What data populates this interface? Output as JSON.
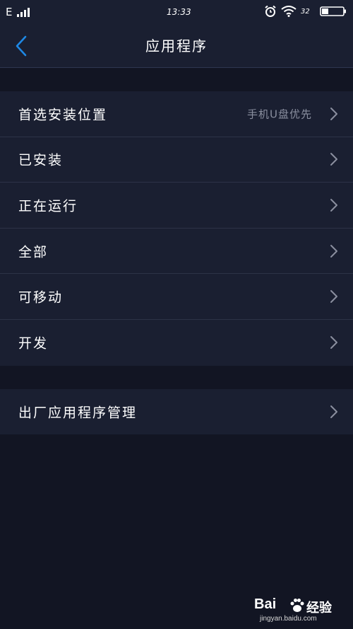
{
  "status_bar": {
    "network": "E",
    "time": "13:33",
    "battery_percent": "32",
    "icons": [
      "signal-icon",
      "alarm-icon",
      "wifi-icon",
      "battery-icon"
    ]
  },
  "nav": {
    "title": "应用程序",
    "back_icon": "chevron-left-icon"
  },
  "groups": [
    {
      "items": [
        {
          "label": "首选安装位置",
          "value": "手机U盘优先"
        },
        {
          "label": "已安装"
        },
        {
          "label": "正在运行"
        },
        {
          "label": "全部"
        },
        {
          "label": "可移动"
        },
        {
          "label": "开发"
        }
      ]
    },
    {
      "items": [
        {
          "label": "出厂应用程序管理"
        }
      ]
    }
  ],
  "watermark": {
    "brand": "Bai",
    "suffix": "经验",
    "url": "jingyan.baidu.com"
  },
  "colors": {
    "background": "#121523",
    "panel": "#1a1f31",
    "divider": "#2d3347",
    "accent": "#1e88e5",
    "text": "#ffffff",
    "secondary_text": "#8a8f9f"
  }
}
